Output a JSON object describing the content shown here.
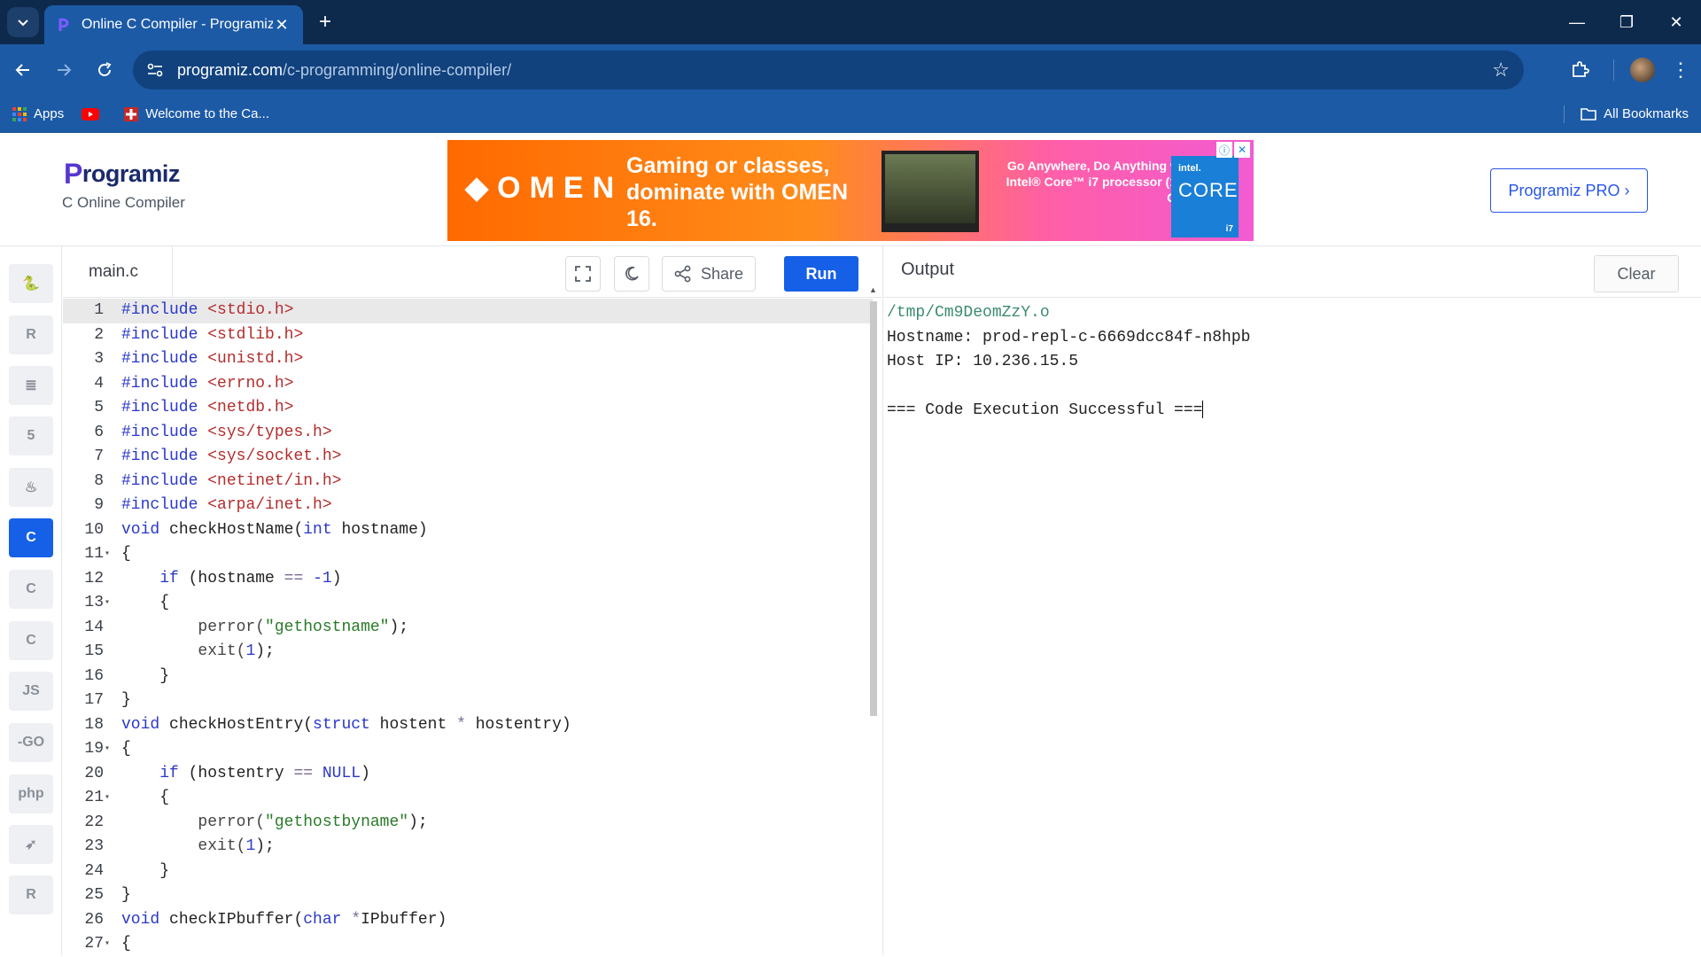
{
  "browser": {
    "tab_title": "Online C Compiler - Programiz",
    "url_host": "programiz.com",
    "url_path": "/c-programming/online-compiler/",
    "bookmarks": [
      {
        "label": "Apps",
        "icon": "apps-grid-icon"
      },
      {
        "label": "",
        "icon": "youtube-icon"
      },
      {
        "label": "Welcome to the Ca...",
        "icon": "site-favicon-icon"
      }
    ],
    "all_bookmarks_label": "All Bookmarks"
  },
  "header": {
    "brand": "rogramiz",
    "brand_initial": "P",
    "subtitle": "C Online Compiler",
    "pro_button": "Programiz PRO ›"
  },
  "ad": {
    "logo": "◆OMEN",
    "headline": "Gaming or classes, dominate with OMEN 16.",
    "tagline": "Go Anywhere, Do Anything with Intel® Core™ i7 processor (14th Gen)",
    "intel_brand": "intel.",
    "intel_core": "CORE",
    "intel_tier": "i7"
  },
  "sidebar": {
    "languages": [
      {
        "name": "python",
        "glyph": "🐍",
        "active": false
      },
      {
        "name": "r",
        "glyph": "R",
        "active": false
      },
      {
        "name": "sql",
        "glyph": "≣",
        "active": false
      },
      {
        "name": "html",
        "glyph": "5",
        "active": false
      },
      {
        "name": "java",
        "glyph": "♨",
        "active": false
      },
      {
        "name": "c",
        "glyph": "C",
        "active": true
      },
      {
        "name": "cpp",
        "glyph": "C",
        "active": false
      },
      {
        "name": "csharp",
        "glyph": "C",
        "active": false
      },
      {
        "name": "javascript",
        "glyph": "JS",
        "active": false
      },
      {
        "name": "go",
        "glyph": "-GO",
        "active": false
      },
      {
        "name": "php",
        "glyph": "php",
        "active": false
      },
      {
        "name": "swift",
        "glyph": "➶",
        "active": false
      },
      {
        "name": "rust",
        "glyph": "R",
        "active": false
      }
    ]
  },
  "editor": {
    "filename": "main.c",
    "share_label": "Share",
    "run_label": "Run",
    "lines": [
      {
        "n": "1",
        "fold": ""
      },
      {
        "n": "2",
        "fold": ""
      },
      {
        "n": "3",
        "fold": ""
      },
      {
        "n": "4",
        "fold": ""
      },
      {
        "n": "5",
        "fold": ""
      },
      {
        "n": "6",
        "fold": ""
      },
      {
        "n": "7",
        "fold": ""
      },
      {
        "n": "8",
        "fold": ""
      },
      {
        "n": "9",
        "fold": ""
      },
      {
        "n": "10",
        "fold": ""
      },
      {
        "n": "11",
        "fold": "▾"
      },
      {
        "n": "12",
        "fold": ""
      },
      {
        "n": "13",
        "fold": "▾"
      },
      {
        "n": "14",
        "fold": ""
      },
      {
        "n": "15",
        "fold": ""
      },
      {
        "n": "16",
        "fold": ""
      },
      {
        "n": "17",
        "fold": ""
      },
      {
        "n": "18",
        "fold": ""
      },
      {
        "n": "19",
        "fold": "▾"
      },
      {
        "n": "20",
        "fold": ""
      },
      {
        "n": "21",
        "fold": "▾"
      },
      {
        "n": "22",
        "fold": ""
      },
      {
        "n": "23",
        "fold": ""
      },
      {
        "n": "24",
        "fold": ""
      },
      {
        "n": "25",
        "fold": ""
      },
      {
        "n": "26",
        "fold": ""
      },
      {
        "n": "27",
        "fold": "▾"
      }
    ],
    "code": [
      [
        [
          "k",
          "#include"
        ],
        [
          "t",
          " "
        ],
        [
          "s",
          "<stdio.h>"
        ]
      ],
      [
        [
          "k",
          "#include"
        ],
        [
          "t",
          " "
        ],
        [
          "s",
          "<stdlib.h>"
        ]
      ],
      [
        [
          "k",
          "#include"
        ],
        [
          "t",
          " "
        ],
        [
          "s",
          "<unistd.h>"
        ]
      ],
      [
        [
          "k",
          "#include"
        ],
        [
          "t",
          " "
        ],
        [
          "s",
          "<errno.h>"
        ]
      ],
      [
        [
          "k",
          "#include"
        ],
        [
          "t",
          " "
        ],
        [
          "s",
          "<netdb.h>"
        ]
      ],
      [
        [
          "k",
          "#include"
        ],
        [
          "t",
          " "
        ],
        [
          "s",
          "<sys/types.h>"
        ]
      ],
      [
        [
          "k",
          "#include"
        ],
        [
          "t",
          " "
        ],
        [
          "s",
          "<sys/socket.h>"
        ]
      ],
      [
        [
          "k",
          "#include"
        ],
        [
          "t",
          " "
        ],
        [
          "s",
          "<netinet/in.h>"
        ]
      ],
      [
        [
          "k",
          "#include"
        ],
        [
          "t",
          " "
        ],
        [
          "s",
          "<arpa/inet.h>"
        ]
      ],
      [
        [
          "k",
          "void"
        ],
        [
          "t",
          " checkHostName("
        ],
        [
          "k",
          "int"
        ],
        [
          "t",
          " hostname)"
        ]
      ],
      [
        [
          "t",
          "{"
        ]
      ],
      [
        [
          "t",
          "    "
        ],
        [
          "k",
          "if"
        ],
        [
          "t",
          " (hostname "
        ],
        [
          "o",
          "=="
        ],
        [
          "t",
          " "
        ],
        [
          "n",
          "-1"
        ],
        [
          "t",
          ")"
        ]
      ],
      [
        [
          "t",
          "    {"
        ]
      ],
      [
        [
          "t",
          "        "
        ],
        [
          "fn",
          "perror("
        ],
        [
          "g",
          "\"gethostname\""
        ],
        [
          "t",
          ");"
        ]
      ],
      [
        [
          "t",
          "        "
        ],
        [
          "fn",
          "exit("
        ],
        [
          "n",
          "1"
        ],
        [
          "t",
          ");"
        ]
      ],
      [
        [
          "t",
          "    }"
        ]
      ],
      [
        [
          "t",
          "}"
        ]
      ],
      [
        [
          "k",
          "void"
        ],
        [
          "t",
          " checkHostEntry("
        ],
        [
          "k",
          "struct"
        ],
        [
          "t",
          " hostent "
        ],
        [
          "o",
          "*"
        ],
        [
          "t",
          " hostentry)"
        ]
      ],
      [
        [
          "t",
          "{"
        ]
      ],
      [
        [
          "t",
          "    "
        ],
        [
          "k",
          "if"
        ],
        [
          "t",
          " (hostentry "
        ],
        [
          "o",
          "=="
        ],
        [
          "t",
          " "
        ],
        [
          "n",
          "NULL"
        ],
        [
          "t",
          ")"
        ]
      ],
      [
        [
          "t",
          "    {"
        ]
      ],
      [
        [
          "t",
          "        "
        ],
        [
          "fn",
          "perror("
        ],
        [
          "g",
          "\"gethostbyname\""
        ],
        [
          "t",
          ");"
        ]
      ],
      [
        [
          "t",
          "        "
        ],
        [
          "fn",
          "exit("
        ],
        [
          "n",
          "1"
        ],
        [
          "t",
          ");"
        ]
      ],
      [
        [
          "t",
          "    }"
        ]
      ],
      [
        [
          "t",
          "}"
        ]
      ],
      [
        [
          "k",
          "void"
        ],
        [
          "t",
          " checkIPbuffer("
        ],
        [
          "k",
          "char"
        ],
        [
          "t",
          " "
        ],
        [
          "o",
          "*"
        ],
        [
          "t",
          "IPbuffer)"
        ]
      ],
      [
        [
          "t",
          "{"
        ]
      ]
    ]
  },
  "output": {
    "title": "Output",
    "clear_label": "Clear",
    "lines": [
      "/tmp/Cm9DeomZzY.o",
      "Hostname: prod-repl-c-6669dcc84f-n8hpb",
      "Host IP: 10.236.15.5",
      "",
      "=== Code Execution Successful ==="
    ]
  }
}
